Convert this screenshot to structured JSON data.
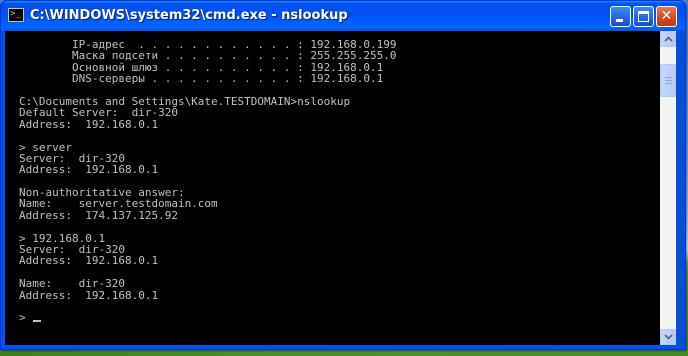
{
  "window": {
    "title": "C:\\WINDOWS\\system32\\cmd.exe - nslookup",
    "icon": "console-icon",
    "icon_glyph": ">_",
    "buttons": {
      "minimize": "minimize-icon",
      "maximize": "maximize-icon",
      "close": "close-icon",
      "close_glyph": "✕"
    }
  },
  "console": {
    "lines": [
      "        IP-адрес  . . . . . . . . . . . . : 192.168.0.199",
      "        Маска подсети . . . . . . . . . . : 255.255.255.0",
      "        Основной шлюз . . . . . . . . . . : 192.168.0.1",
      "        DNS-серверы . . . . . . . . . . . : 192.168.0.1",
      "",
      "C:\\Documents and Settings\\Kate.TESTDOMAIN>nslookup",
      "Default Server:  dir-320",
      "Address:  192.168.0.1",
      "",
      "> server",
      "Server:  dir-320",
      "Address:  192.168.0.1",
      "",
      "Non-authoritative answer:",
      "Name:    server.testdomain.com",
      "Address:  174.137.125.92",
      "",
      "> 192.168.0.1",
      "Server:  dir-320",
      "Address:  192.168.0.1",
      "",
      "Name:    dir-320",
      "Address:  192.168.0.1",
      "",
      "> "
    ]
  },
  "scrollbar": {
    "up_icon": "scroll-up-arrow-icon",
    "down_icon": "scroll-down-arrow-icon"
  },
  "colors": {
    "console_bg": "#000000",
    "console_fg": "#c0c0c0",
    "titlebar": "#0053ee",
    "close_button": "#d4461f"
  }
}
